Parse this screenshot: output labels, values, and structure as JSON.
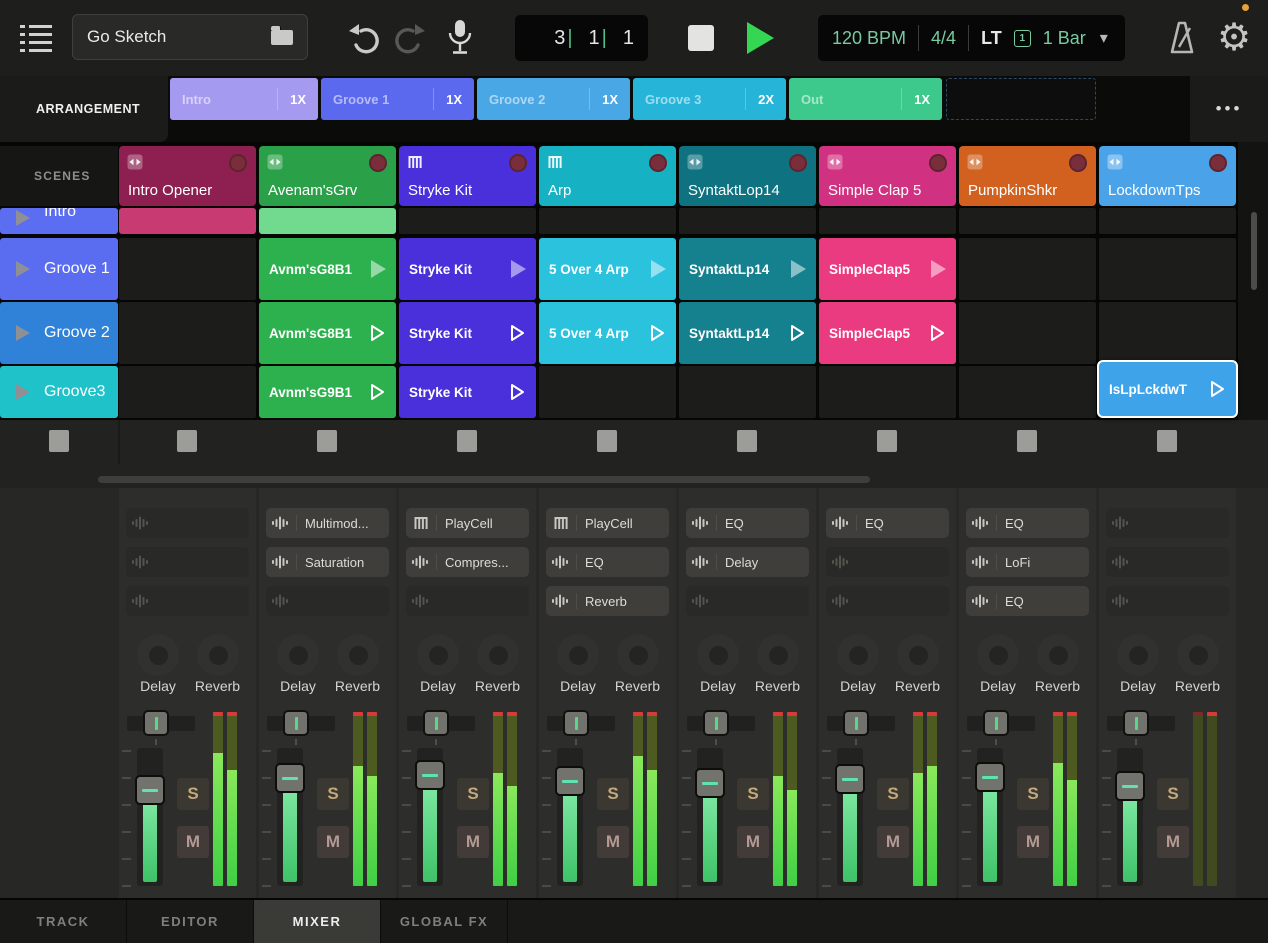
{
  "topbar": {
    "title": "Go Sketch",
    "position": {
      "bar": "3",
      "beat": "1",
      "sixteenth": "1"
    },
    "transport": {
      "tempo": "120 BPM",
      "time_signature": "4/4",
      "launch_mode": "LT",
      "quant_badge": "1",
      "launch_quant": "1 Bar"
    }
  },
  "arrangement": {
    "label": "ARRANGEMENT",
    "more": "•••",
    "sections": [
      {
        "name": "Intro",
        "repeat": "1X",
        "color": "#a49af0"
      },
      {
        "name": "Groove 1",
        "repeat": "1X",
        "color": "#5a69ee"
      },
      {
        "name": "Groove 2",
        "repeat": "1X",
        "color": "#4aa7e6"
      },
      {
        "name": "Groove 3",
        "repeat": "2X",
        "color": "#27b4d9"
      },
      {
        "name": "Out",
        "repeat": "1X",
        "color": "#3ec98c"
      }
    ]
  },
  "scenes": {
    "label": "SCENES",
    "partial": {
      "name": "Intro",
      "color": "#5b6ef2"
    },
    "buttons": [
      {
        "name": "Groove 1",
        "color": "#5a6cf0"
      },
      {
        "name": "Groove 2",
        "color": "#2f82d8"
      },
      {
        "name": "Groove3",
        "color": "#1fc2c9"
      }
    ]
  },
  "tracks": [
    {
      "name": "Intro Opener",
      "color": "#8d2050"
    },
    {
      "name": "Avenam'sGrv",
      "color": "#2aa148"
    },
    {
      "name": "Stryke Kit",
      "color": "#4a30da"
    },
    {
      "name": "Arp",
      "color": "#16b2c4"
    },
    {
      "name": "SyntaktLop14",
      "color": "#0f7280"
    },
    {
      "name": "Simple Clap 5",
      "color": "#d13181"
    },
    {
      "name": "PumpkinShkr",
      "color": "#d2611f"
    },
    {
      "name": "LockdownTps",
      "color": "#4aa3e8"
    }
  ],
  "clips": {
    "partial_row": [
      {
        "color": "#c73a72"
      },
      {
        "color": "#72da8e"
      }
    ],
    "row1": [
      {
        "label": "Avnm'sG8B1",
        "color": "#2db04e"
      },
      {
        "label": "Stryke Kit",
        "color": "#4a30da"
      },
      {
        "label": "5 Over 4 Arp",
        "color": "#2bc2de"
      },
      {
        "label": "SyntaktLp14",
        "color": "#15818f"
      },
      {
        "label": "SimpleClap5",
        "color": "#ea3b80"
      }
    ],
    "row2": [
      {
        "label": "Avnm'sG8B1",
        "color": "#2db04e"
      },
      {
        "label": "Stryke Kit",
        "color": "#4a30da"
      },
      {
        "label": "5 Over 4 Arp",
        "color": "#2bc2de"
      },
      {
        "label": "SyntaktLp14",
        "color": "#15818f"
      },
      {
        "label": "SimpleClap5",
        "color": "#ea3b80"
      }
    ],
    "row3": [
      {
        "label": "Avnm'sG9B1",
        "color": "#2db04e"
      },
      {
        "label": "Stryke Kit",
        "color": "#4a30da"
      },
      {
        "label": "IsLpLckdwT",
        "color": "#3fa3ea"
      }
    ]
  },
  "mixer": {
    "send1": "Delay",
    "send2": "Reverb",
    "solo": "S",
    "mute": "M",
    "channels": [
      {
        "devices": [
          null,
          null,
          null
        ]
      },
      {
        "devices": [
          {
            "label": "Multimod..."
          },
          {
            "label": "Saturation"
          },
          null
        ]
      },
      {
        "devices": [
          {
            "label": "PlayCell",
            "icon": "keys"
          },
          {
            "label": "Compres..."
          },
          null
        ]
      },
      {
        "devices": [
          {
            "label": "PlayCell",
            "icon": "keys"
          },
          {
            "label": "EQ"
          },
          {
            "label": "Reverb"
          }
        ]
      },
      {
        "devices": [
          {
            "label": "EQ"
          },
          {
            "label": "Delay"
          },
          null
        ]
      },
      {
        "devices": [
          {
            "label": "EQ"
          },
          null,
          null
        ]
      },
      {
        "devices": [
          {
            "label": "EQ"
          },
          {
            "label": "LoFi"
          },
          {
            "label": "EQ"
          }
        ]
      },
      {
        "devices": [
          null,
          null,
          null
        ]
      }
    ]
  },
  "tabs": [
    {
      "label": "TRACK"
    },
    {
      "label": "EDITOR"
    },
    {
      "label": "MIXER"
    },
    {
      "label": "GLOBAL FX"
    }
  ]
}
